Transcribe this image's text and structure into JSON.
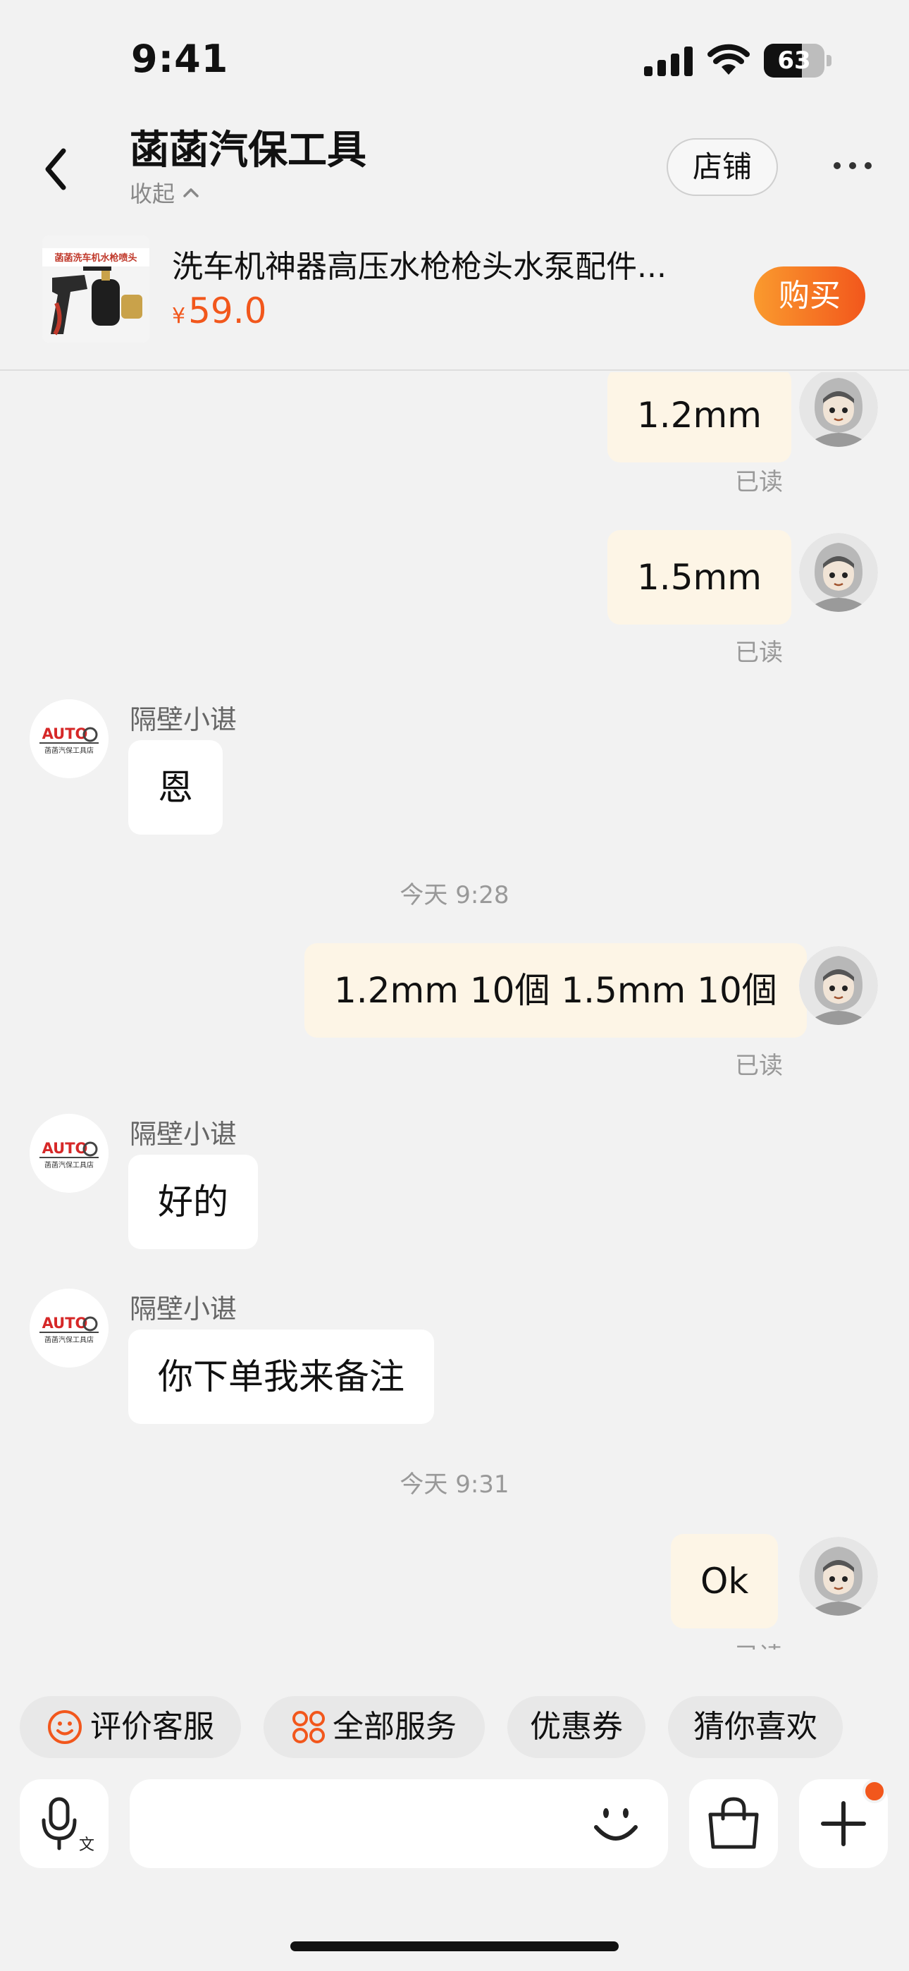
{
  "status_bar": {
    "time": "9:41",
    "battery": 63
  },
  "header": {
    "title": "菡菡汽保工具",
    "collapse_label": "收起",
    "store_button": "店铺"
  },
  "product": {
    "thumb_caption": "菡菡洗车机水枪喷头",
    "title": "洗车机神器高压水枪枪头水泵配件...",
    "price_currency": "¥",
    "price": "59.0",
    "buy_button": "购买"
  },
  "chat": {
    "read_label": "已读",
    "shop_sender": "隔壁小谌",
    "avatar_brand": "AUTO",
    "avatar_caption": "菡菡汽保工具店",
    "messages": [
      {
        "dir": "out",
        "text": "1.2mm"
      },
      {
        "dir": "out",
        "text": "1.5mm"
      },
      {
        "dir": "in",
        "text": "恩"
      },
      {
        "dir": "time",
        "text": "今天 9:28"
      },
      {
        "dir": "out",
        "text": "1.2mm 10個 1.5mm 10個"
      },
      {
        "dir": "in",
        "text": "好的"
      },
      {
        "dir": "in",
        "text": "你下单我来备注"
      },
      {
        "dir": "time",
        "text": "今天 9:31"
      },
      {
        "dir": "out",
        "text": "Ok"
      }
    ]
  },
  "quick_actions": [
    "评价客服",
    "全部服务",
    "优惠券",
    "猜你喜欢"
  ],
  "input": {
    "placeholder": ""
  },
  "colors": {
    "accent": "#f2571c",
    "out_bubble": "#fdf5e6",
    "background": "#f2f2f2"
  }
}
